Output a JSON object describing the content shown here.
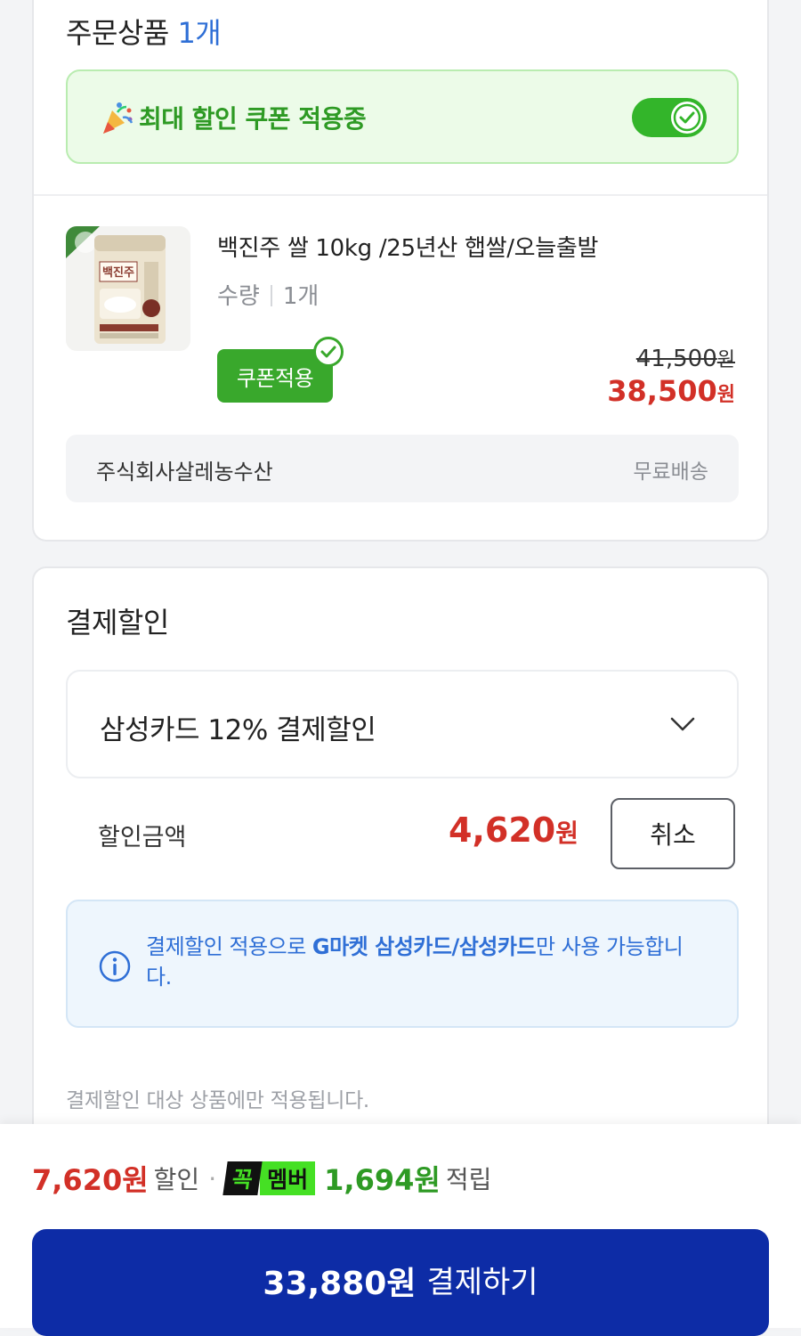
{
  "order": {
    "title": "주문상품",
    "count": "1개",
    "coupon_banner": "최대 할인 쿠폰 적용중",
    "coupon_toggle_on": true,
    "product": {
      "name": "백진주 쌀 10kg /25년산 햅쌀/오늘출발",
      "qty_label": "수량",
      "qty_value": "1개",
      "coupon_badge": "쿠폰적용",
      "original_price": "41,500",
      "final_price": "38,500",
      "currency": "원",
      "package_text": "백진주"
    },
    "seller": "주식회사살레농수산",
    "shipping": "무료배송"
  },
  "payment_discount": {
    "title": "결제할인",
    "selected_option": "삼성카드 12% 결제할인",
    "amount_label": "할인금액",
    "amount": "4,620",
    "currency": "원",
    "cancel_label": "취소",
    "info_prefix": "결제할인 적용으로 ",
    "info_bold": "G마켓 삼성카드/삼성카드",
    "info_suffix": "만 사용 가능합니다.",
    "note": "결제할인 대상 상품에만 적용됩니다."
  },
  "bottom": {
    "discount_amount": "7,620원",
    "discount_word": "할인",
    "separator": "·",
    "badge_left": "꼭",
    "badge_right": "멤버",
    "points_amount": "1,694원",
    "points_word": "적립",
    "pay_amount": "33,880원",
    "pay_label": "결제하기"
  },
  "colors": {
    "primary_blue": "#0d2ca6",
    "price_red": "#d23027",
    "coupon_green": "#39a82c",
    "link_blue": "#2f6fd6"
  }
}
